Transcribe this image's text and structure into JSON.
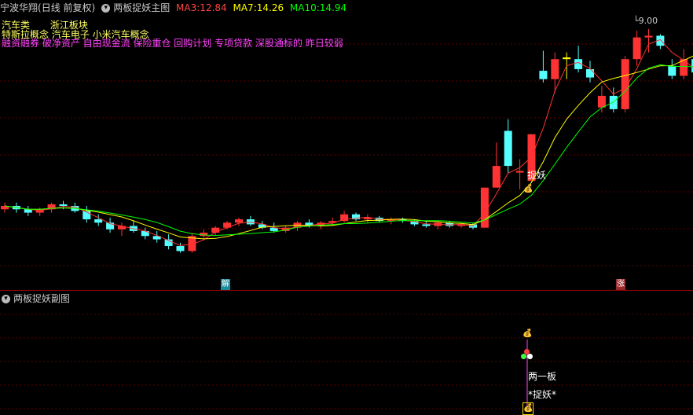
{
  "main_header": {
    "stock_name": "宁波华翔",
    "mode": "(日线 前复权)",
    "indicator_name": "两板捉妖主图",
    "ma3_label": "MA3:",
    "ma3_value": "12.84",
    "ma7_label": "MA7:",
    "ma7_value": "14.26",
    "ma10_label": "MA10:",
    "ma10_value": "14.94"
  },
  "concepts": {
    "line1a": "汽车类",
    "line1b": "浙江板块",
    "line2": "特斯拉概念 汽车电子 小米汽车概念",
    "line3": "融资融券 破净资产 自由现金流 保险重仓 回购计划 专项贷款 深股通标的 昨日较弱"
  },
  "annotations": {
    "price_max": "9.00",
    "signal_main": "捉妖",
    "marker_jie": "解",
    "marker_zhang": "涨"
  },
  "sub_header": {
    "indicator_name": "两板捉妖副图"
  },
  "sub_annotations": {
    "label_two_boards": "两一板",
    "label_catch": "*捉妖*"
  },
  "colors": {
    "up": "#ff3333",
    "down": "#54ffff",
    "signal": "#ffff00",
    "ma3": "#ffffff",
    "ma7": "#ffff00",
    "ma10": "#00ff00",
    "grid": "#5a0000",
    "purple": "#ff44ff"
  },
  "chart_data": {
    "type": "candlestick",
    "series": [
      {
        "name": "candles",
        "ohlc": [
          [
            13.1,
            13.3,
            13.0,
            13.2
          ],
          [
            13.2,
            13.3,
            13.0,
            13.1
          ],
          [
            13.1,
            13.2,
            12.9,
            13.0
          ],
          [
            13.0,
            13.15,
            12.9,
            13.1
          ],
          [
            13.1,
            13.3,
            13.0,
            13.25
          ],
          [
            13.25,
            13.35,
            13.1,
            13.2
          ],
          [
            13.2,
            13.3,
            13.0,
            13.05
          ],
          [
            13.05,
            13.2,
            12.7,
            12.8
          ],
          [
            12.8,
            12.95,
            12.6,
            12.7
          ],
          [
            12.7,
            12.85,
            12.4,
            12.5
          ],
          [
            12.5,
            12.7,
            12.3,
            12.6
          ],
          [
            12.6,
            12.75,
            12.4,
            12.45
          ],
          [
            12.45,
            12.55,
            12.2,
            12.3
          ],
          [
            12.3,
            12.45,
            12.1,
            12.2
          ],
          [
            12.2,
            12.35,
            11.9,
            12.0
          ],
          [
            12.0,
            12.1,
            11.8,
            11.85
          ],
          [
            11.85,
            12.4,
            11.8,
            12.3
          ],
          [
            12.3,
            12.5,
            12.2,
            12.4
          ],
          [
            12.4,
            12.6,
            12.3,
            12.55
          ],
          [
            12.55,
            12.75,
            12.5,
            12.7
          ],
          [
            12.7,
            12.85,
            12.6,
            12.8
          ],
          [
            12.8,
            12.9,
            12.6,
            12.65
          ],
          [
            12.65,
            12.75,
            12.5,
            12.55
          ],
          [
            12.55,
            12.7,
            12.4,
            12.45
          ],
          [
            12.45,
            12.6,
            12.4,
            12.55
          ],
          [
            12.55,
            12.75,
            12.45,
            12.7
          ],
          [
            12.7,
            12.8,
            12.55,
            12.6
          ],
          [
            12.6,
            12.75,
            12.5,
            12.7
          ],
          [
            12.7,
            12.85,
            12.6,
            12.75
          ],
          [
            12.75,
            13.05,
            12.7,
            12.95
          ],
          [
            12.95,
            13.0,
            12.75,
            12.8
          ],
          [
            12.8,
            12.95,
            12.7,
            12.85
          ],
          [
            12.85,
            12.9,
            12.7,
            12.75
          ],
          [
            12.75,
            12.85,
            12.65,
            12.8
          ],
          [
            12.8,
            12.85,
            12.7,
            12.75
          ],
          [
            12.75,
            12.8,
            12.6,
            12.65
          ],
          [
            12.65,
            12.75,
            12.55,
            12.6
          ],
          [
            12.6,
            12.75,
            12.5,
            12.7
          ],
          [
            12.7,
            12.75,
            12.55,
            12.6
          ],
          [
            12.6,
            12.7,
            12.55,
            12.65
          ],
          [
            12.65,
            12.7,
            12.5,
            12.55
          ],
          [
            12.55,
            13.75,
            12.55,
            13.75
          ],
          [
            13.75,
            15.1,
            13.75,
            14.4
          ],
          [
            15.45,
            15.8,
            14.2,
            14.4
          ],
          [
            14.2,
            14.6,
            13.7,
            14.25
          ],
          [
            13.95,
            15.35,
            13.9,
            15.35
          ],
          [
            17.25,
            17.85,
            16.9,
            17.0
          ],
          [
            17.0,
            17.8,
            16.6,
            17.6
          ],
          [
            17.65,
            17.8,
            17.0,
            17.6
          ],
          [
            17.6,
            18.0,
            17.2,
            17.3
          ],
          [
            17.3,
            17.55,
            16.9,
            17.05
          ],
          [
            16.15,
            16.8,
            16.0,
            16.5
          ],
          [
            16.5,
            16.75,
            16.0,
            16.1
          ],
          [
            16.1,
            17.7,
            16.0,
            17.6
          ],
          [
            17.6,
            18.45,
            17.4,
            18.25
          ],
          [
            18.25,
            18.5,
            17.8,
            18.3
          ],
          [
            18.3,
            18.35,
            17.9,
            18.0
          ],
          [
            17.4,
            17.6,
            17.0,
            17.1
          ],
          [
            17.1,
            17.9,
            17.0,
            17.6
          ],
          [
            17.6,
            17.7,
            17.1,
            17.2
          ]
        ]
      },
      {
        "name": "MA3"
      },
      {
        "name": "MA7"
      },
      {
        "name": "MA10"
      }
    ]
  }
}
